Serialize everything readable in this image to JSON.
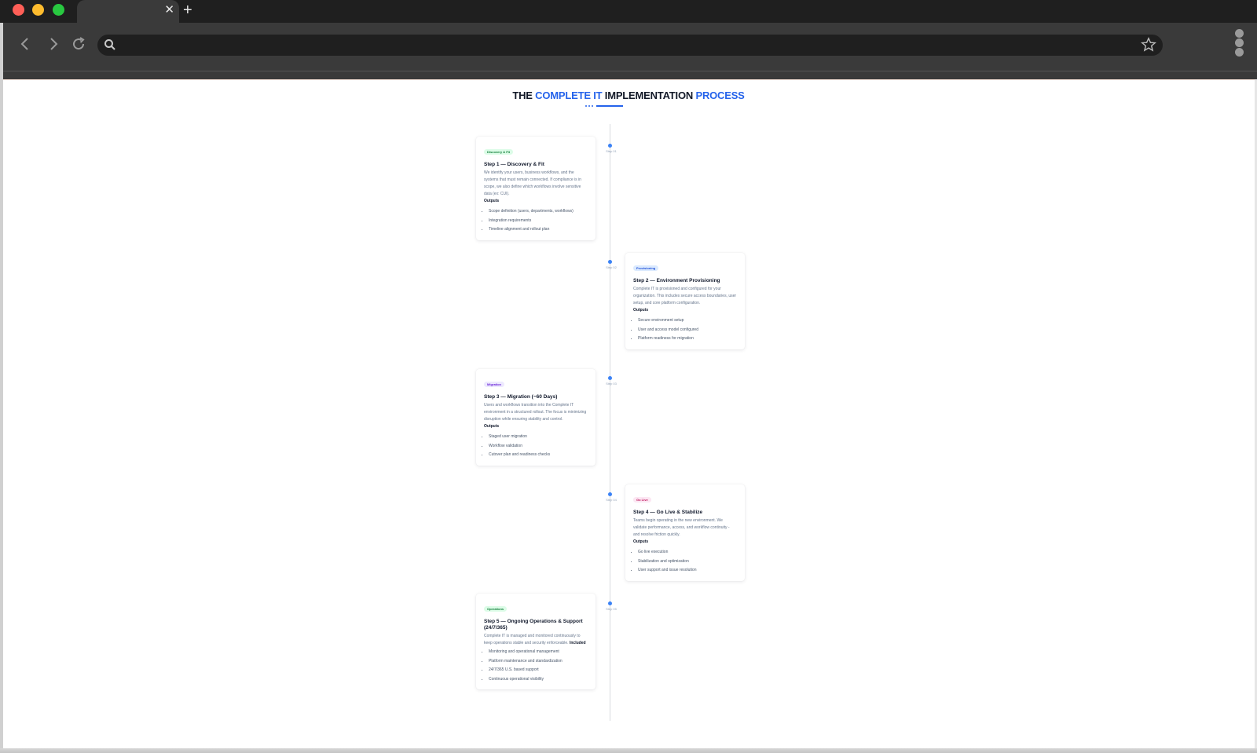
{
  "browser": {
    "tab_close": "✕",
    "new_tab": "+",
    "omnibox_value": ""
  },
  "page": {
    "title_parts": [
      "THE ",
      "COMPLETE IT",
      " IMPLEMENTATION ",
      "PROCESS"
    ]
  },
  "steps": [
    {
      "marker": "Step 01",
      "badge": "Discovery & Fit",
      "title": "Step 1 — Discovery & Fit",
      "desc": "We identify your users, business workflows, and the systems that must remain connected. If compliance is in scope, we also define which workflows involve sensitive data (ex: CUI).",
      "list_label": "Outputs",
      "items": [
        "Scope definition (users, departments, workflows)",
        "Integration requirements",
        "Timeline alignment and rollout plan"
      ]
    },
    {
      "marker": "Step 02",
      "badge": "Provisioning",
      "title": "Step 2 — Environment Provisioning",
      "desc": "Complete IT is provisioned and configured for your organization. This includes secure access boundaries, user setup, and core platform configuration.",
      "list_label": "Outputs",
      "items": [
        "Secure environment setup",
        "User and access model configured",
        "Platform readiness for migration"
      ]
    },
    {
      "marker": "Step 03",
      "badge": "Migration",
      "title": "Step 3 — Migration (~60 Days)",
      "desc": "Users and workflows transition into the Complete IT environment in a structured rollout. The focus is minimizing disruption while ensuring stability and control.",
      "list_label": "Outputs",
      "items": [
        "Staged user migration",
        "Workflow validation",
        "Cutover plan and readiness checks"
      ]
    },
    {
      "marker": "Step 04",
      "badge": "Go Live",
      "title": "Step 4 — Go Live & Stabilize",
      "desc": "Teams begin operating in the new environment. We validate performance, access, and workflow continuity - and resolve friction quickly.",
      "list_label": "Outputs",
      "items": [
        "Go live execution",
        "Stabilization and optimization",
        "User support and issue resolution"
      ]
    },
    {
      "marker": "Step 05",
      "badge": "Operations",
      "title": "Step 5 — Ongoing Operations & Support (24/7/365)",
      "desc": "Complete IT is managed and monitored continuously to keep operations stable and security enforceable.",
      "list_label": "Included",
      "items": [
        "Monitoring and operational management",
        "Platform maintenance and standardization",
        "24/7/365 U.S. based support",
        "Continuous operational visibility"
      ]
    }
  ],
  "colors": {
    "accent": "#2563eb",
    "node": "#3b82f6",
    "badge_green": "#dcfce7",
    "badge_blue": "#dbeafe",
    "badge_purple": "#ede9fe",
    "badge_pink": "#fce7f3"
  }
}
